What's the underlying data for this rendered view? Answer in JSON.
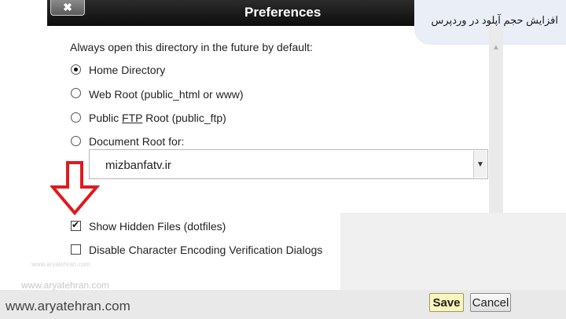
{
  "dialog": {
    "title": "Preferences",
    "close_label": "✖"
  },
  "badge": {
    "text": "افزایش حجم آپلود در وردپرس"
  },
  "content": {
    "intro": "Always open this directory in the future by default:",
    "radios": [
      {
        "label": "Home Directory",
        "checked": true
      },
      {
        "label": "Web Root (public_html or www)",
        "checked": false
      },
      {
        "label_pre": "Public ",
        "label_u": "FTP",
        "label_post": " Root (public_ftp)",
        "checked": false
      },
      {
        "label": "Document Root for:",
        "checked": false
      }
    ],
    "domain_select": {
      "value": "mizbanfatv.ir"
    },
    "checkboxes": [
      {
        "label": "Show Hidden Files (dotfiles)",
        "checked": true
      },
      {
        "label": "Disable Character Encoding Verification Dialogs",
        "checked": false
      }
    ]
  },
  "buttons": {
    "save": "Save",
    "cancel": "Cancel"
  },
  "watermarks": {
    "tiny": "www.aryatehran.com",
    "small": "www.aryatehran.com",
    "main": "www.aryatehran.com"
  },
  "icons": {
    "close": "close-icon",
    "down_arrow": "down-arrow-icon",
    "chevron": "chevron-down-icon",
    "scroll_up": "scroll-up-icon",
    "arrow_color": "#e0191d",
    "save_color": "#fbf6bc"
  }
}
